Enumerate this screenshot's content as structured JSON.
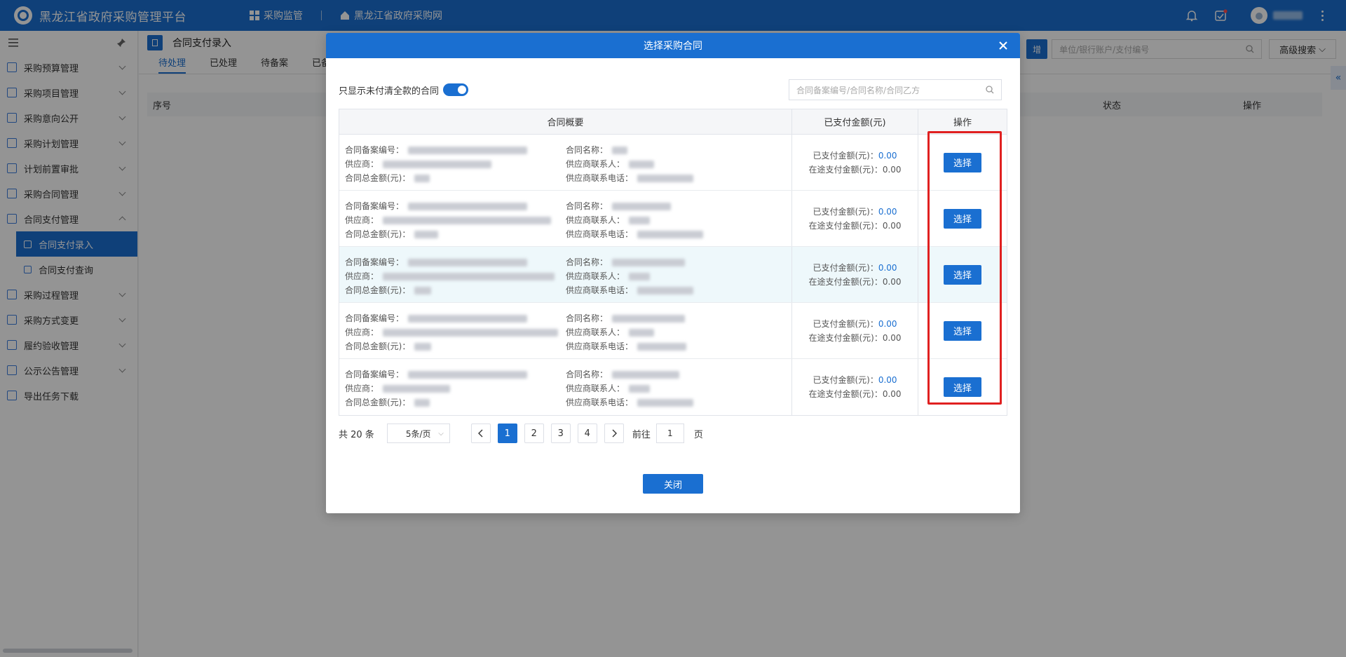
{
  "header": {
    "app_title": "黑龙江省政府采购管理平台",
    "nav_monitor": "采购监管",
    "nav_site": "黑龙江省政府采购网"
  },
  "sidebar": {
    "items": [
      {
        "label": "采购预算管理"
      },
      {
        "label": "采购项目管理"
      },
      {
        "label": "采购意向公开"
      },
      {
        "label": "采购计划管理"
      },
      {
        "label": "计划前置审批"
      },
      {
        "label": "采购合同管理"
      },
      {
        "label": "合同支付管理"
      },
      {
        "label": "采购过程管理"
      },
      {
        "label": "采购方式变更"
      },
      {
        "label": "履约验收管理"
      },
      {
        "label": "公示公告管理"
      },
      {
        "label": "导出任务下载"
      }
    ],
    "sub_items": [
      {
        "label": "合同支付录入"
      },
      {
        "label": "合同支付查询"
      }
    ]
  },
  "page": {
    "title": "合同支付录入",
    "tabs": [
      "待处理",
      "已处理",
      "待备案",
      "已备"
    ],
    "btn_stub": "增",
    "search_placeholder": "单位/银行账户/支付编号",
    "advanced_search": "高级搜索",
    "columns": {
      "seq": "序号",
      "status": "状态",
      "action": "操作"
    }
  },
  "modal": {
    "title": "选择采购合同",
    "toggle_label": "只显示未付清全款的合同",
    "search_placeholder": "合同备案编号/合同名称/合同乙方",
    "columns": {
      "summary": "合同概要",
      "paid": "已支付金额(元)",
      "action": "操作"
    },
    "labels": {
      "record_no": "合同备案编号：",
      "supplier": "供应商：",
      "total": "合同总金额(元)：",
      "name": "合同名称：",
      "contact": "供应商联系人：",
      "phone": "供应商联系电话：",
      "paid": "已支付金额(元)：",
      "in_transit": "在途支付金额(元)："
    },
    "rows": [
      {
        "paid": "0.00",
        "in_transit": "0.00",
        "action": "选择"
      },
      {
        "paid": "0.00",
        "in_transit": "0.00",
        "action": "选择"
      },
      {
        "paid": "0.00",
        "in_transit": "0.00",
        "action": "选择"
      },
      {
        "paid": "0.00",
        "in_transit": "0.00",
        "action": "选择"
      },
      {
        "paid": "0.00",
        "in_transit": "0.00",
        "action": "选择"
      }
    ],
    "pager": {
      "total": "共 20 条",
      "page_size": "5条/页",
      "pages": [
        "1",
        "2",
        "3",
        "4"
      ],
      "goto_label": "前往",
      "goto_value": "1",
      "page_unit": "页"
    },
    "close_label": "关闭"
  }
}
